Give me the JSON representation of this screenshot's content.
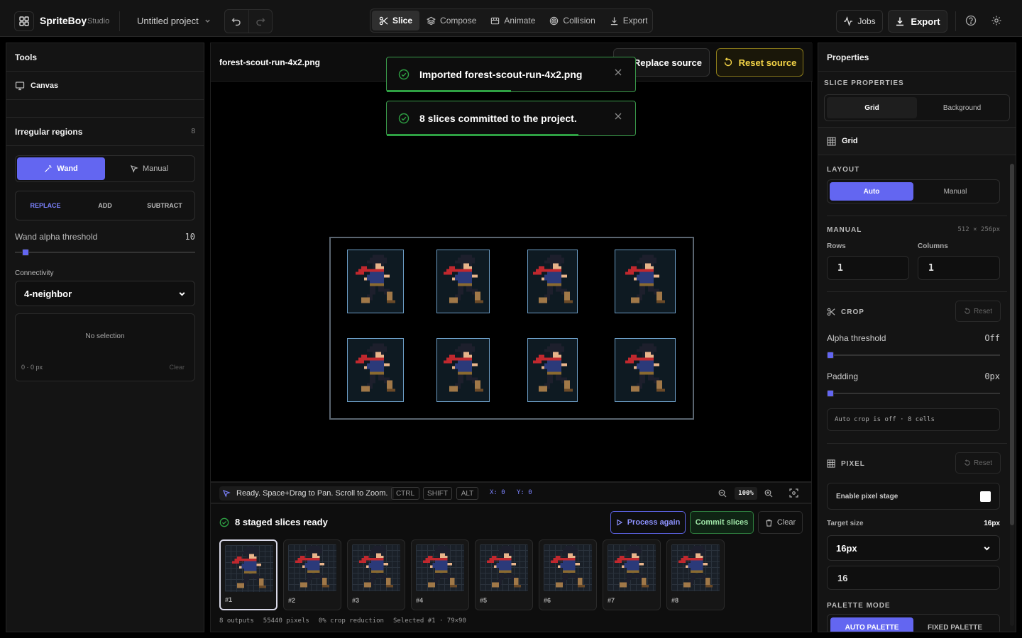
{
  "app": {
    "name": "SpriteBoy",
    "subtitle": "Studio",
    "project": "Untitled project"
  },
  "modes": [
    {
      "label": "Slice",
      "icon": "scissors-icon"
    },
    {
      "label": "Compose",
      "icon": "layers-icon"
    },
    {
      "label": "Animate",
      "icon": "film-icon"
    },
    {
      "label": "Collision",
      "icon": "target-icon"
    },
    {
      "label": "Export",
      "icon": "download-icon"
    }
  ],
  "toolbar": {
    "jobs": "Jobs",
    "export": "Export"
  },
  "left": {
    "tools_title": "Tools",
    "canvas_label": "Canvas",
    "irregular_title": "Irregular regions",
    "irregular_count": "8",
    "wand": "Wand",
    "manual": "Manual",
    "ops": [
      "REPLACE",
      "ADD",
      "SUBTRACT"
    ],
    "threshold_label": "Wand alpha threshold",
    "threshold_value": "10",
    "threshold_level": 0.04,
    "connectivity_label": "Connectivity",
    "connectivity_value": "4-neighbor",
    "no_selection": "No selection",
    "selection_size": "0 · 0 px",
    "clear": "Clear"
  },
  "center": {
    "filename": "forest-scout-run-4x2.png",
    "replace_source": "Replace source",
    "reset_source": "Reset source"
  },
  "toasts": [
    {
      "text": "Imported forest-scout-run-4x2.png",
      "progress": 0.5
    },
    {
      "text": "8 slices committed to the project.",
      "progress": 0.77
    }
  ],
  "status": {
    "hint": "Ready. Space+Drag to Pan. Scroll to Zoom.",
    "keys": [
      "CTRL",
      "SHIFT",
      "ALT"
    ],
    "x": "X: 0",
    "y": "Y: 0",
    "zoom": "100%"
  },
  "staged": {
    "title": "8 staged slices ready",
    "process_again": "Process again",
    "commit": "Commit slices",
    "clear": "Clear",
    "items": [
      "#1",
      "#2",
      "#3",
      "#4",
      "#5",
      "#6",
      "#7",
      "#8"
    ],
    "footer": [
      "8 outputs",
      "55440 pixels",
      "0% crop reduction",
      "Selected #1 · 79×90"
    ]
  },
  "right": {
    "properties": "Properties",
    "slice_properties": "SLICE PROPERTIES",
    "slice_tabs": [
      "Grid",
      "Background"
    ],
    "grid_title": "Grid",
    "layout": "LAYOUT",
    "layout_tabs": [
      "Auto",
      "Manual"
    ],
    "manual_title": "MANUAL",
    "manual_size": "512 × 256px",
    "rows_label": "Rows",
    "rows_value": "1",
    "cols_label": "Columns",
    "cols_value": "1",
    "crop_title": "CROP",
    "reset": "Reset",
    "alpha_label": "Alpha threshold",
    "alpha_value": "Off",
    "padding_label": "Padding",
    "padding_value": "0px",
    "crop_note": "Auto crop is off · 8 cells",
    "pixel_title": "PIXEL",
    "pixel_reset": "Reset",
    "enable_pixel": "Enable pixel stage",
    "target_label": "Target size",
    "target_value": "16px",
    "target_select": "16px",
    "target_input": "16",
    "palette_title": "PALETTE MODE",
    "palette_tabs": [
      "AUTO PALETTE",
      "FIXED PALETTE"
    ]
  },
  "colors": {
    "accent": "#6366f1",
    "success": "#2ea043",
    "warning": "#f5d547"
  }
}
